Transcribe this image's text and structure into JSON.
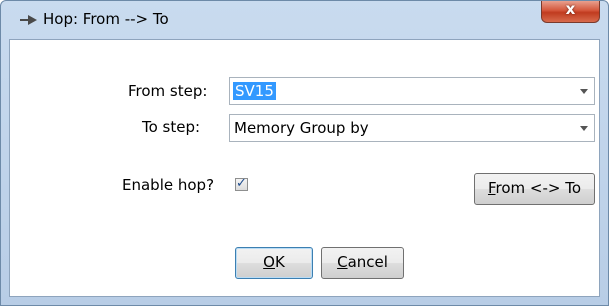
{
  "window": {
    "title": "Hop: From --> To",
    "close_glyph": "x"
  },
  "form": {
    "from_label": "From step:",
    "from_value": "SV15",
    "to_label": "To step:",
    "to_value": "Memory Group by",
    "enable_label": "Enable hop?",
    "enable_checked": true
  },
  "buttons": {
    "swap_mnemonic": "F",
    "swap_rest": "rom <-> To",
    "ok_mnemonic": "O",
    "ok_rest": "K",
    "cancel_mnemonic": "C",
    "cancel_rest": "ancel"
  },
  "icons": {
    "title": "hop-arrow-icon",
    "dropdown": "chevron-down-icon",
    "check": "checkmark-icon"
  }
}
